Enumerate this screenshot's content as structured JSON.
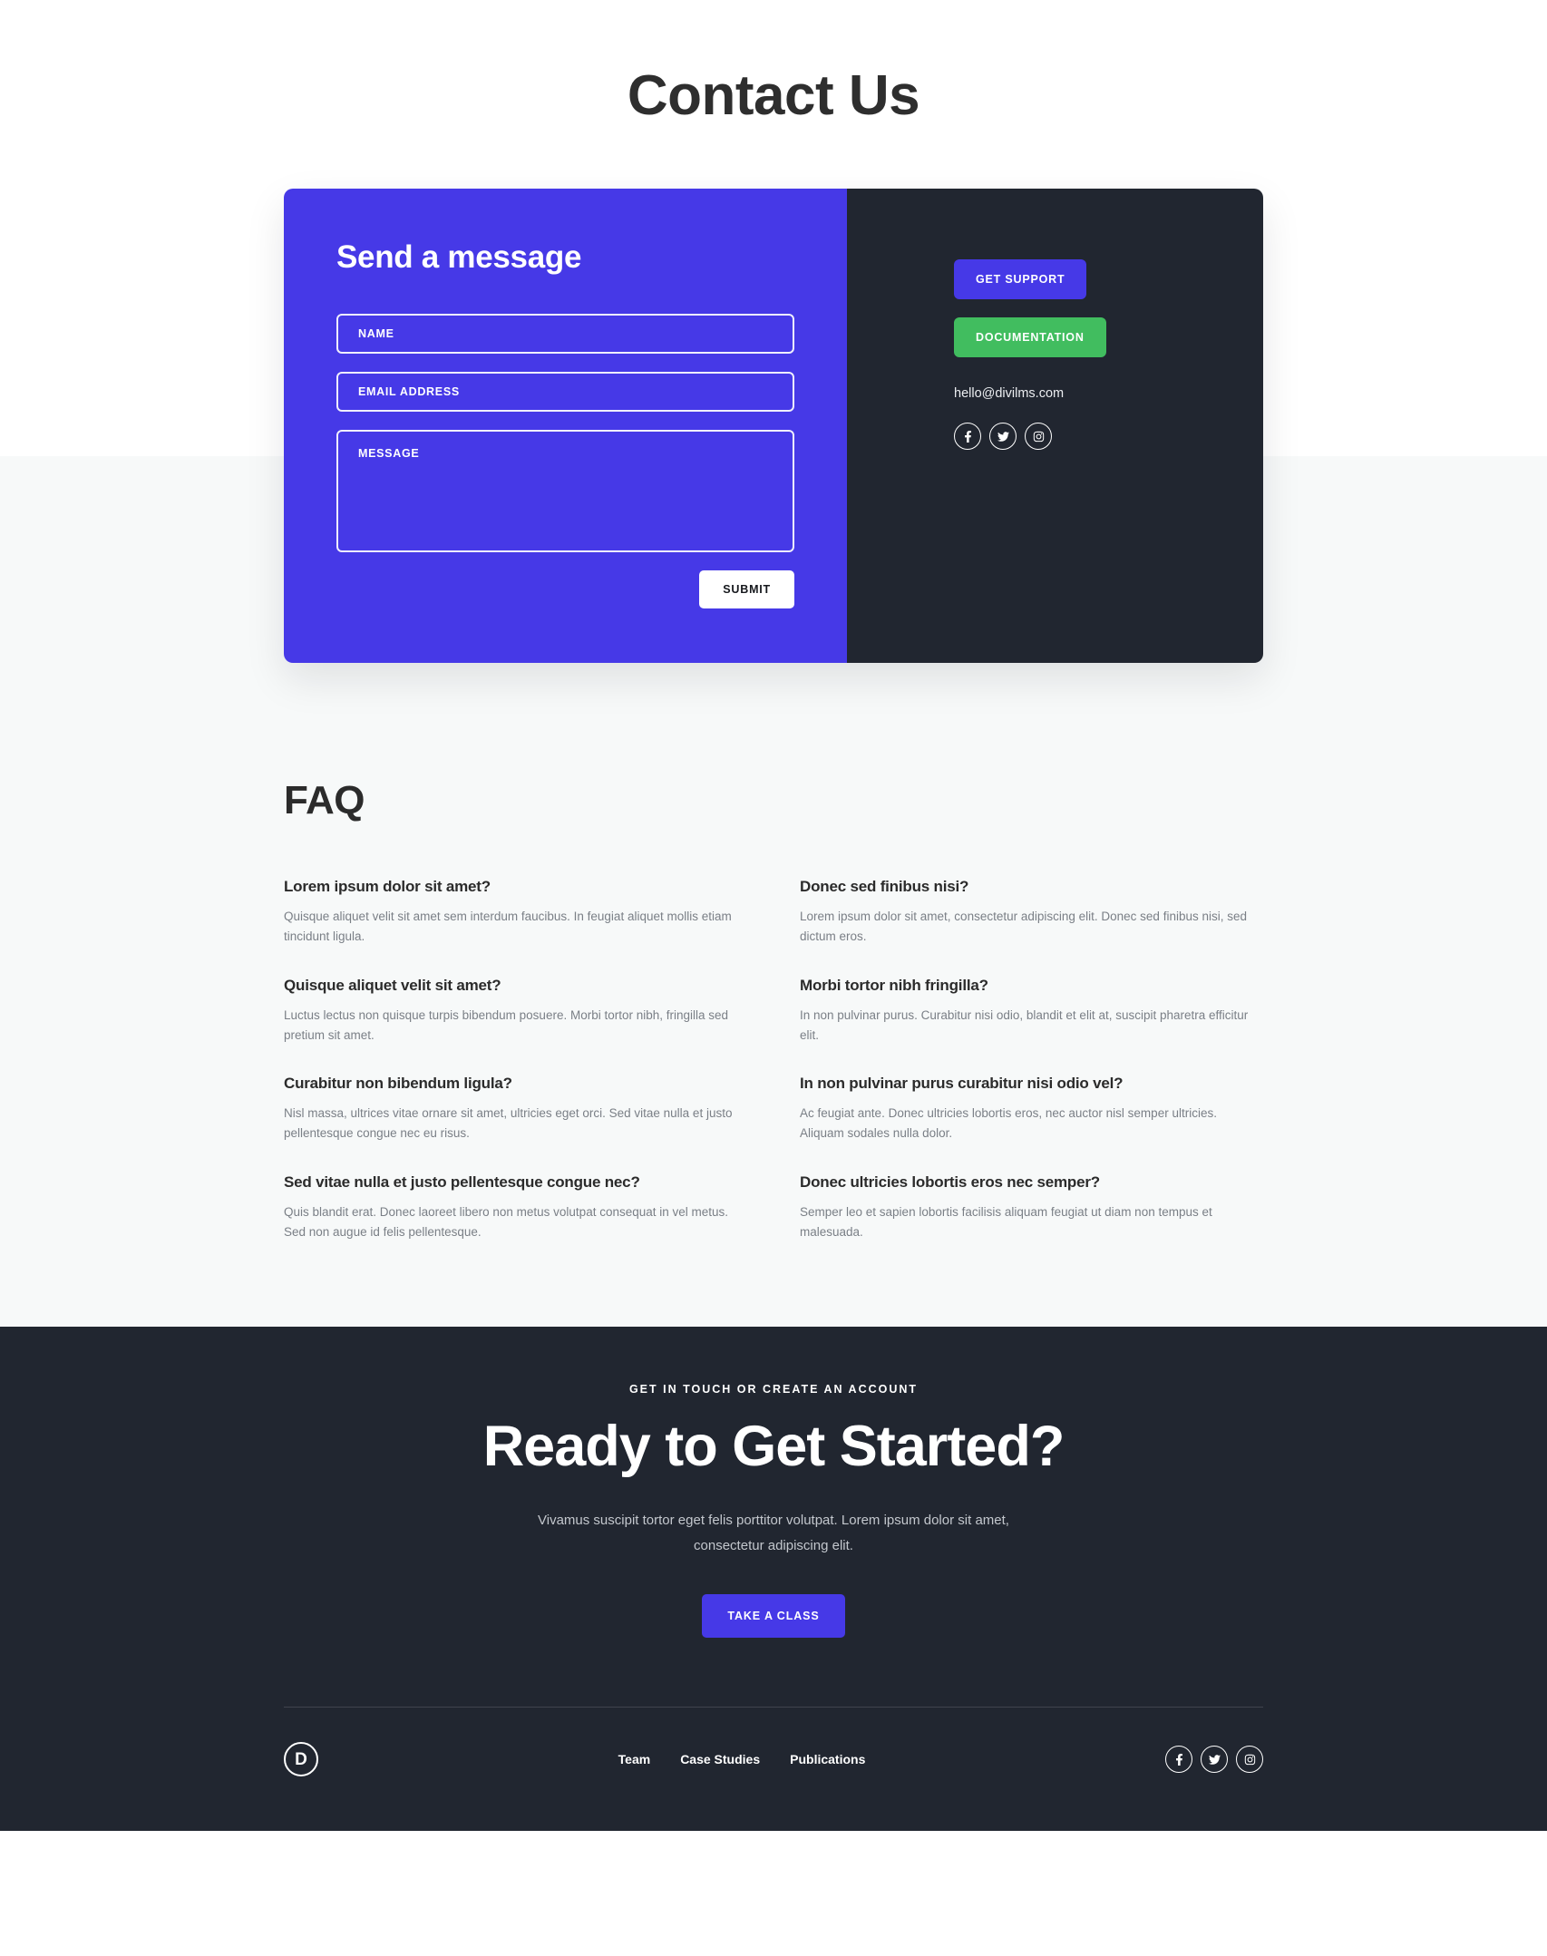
{
  "page": {
    "title": "Contact Us",
    "accent_blue": "#4639e7",
    "accent_green": "#41bd5f",
    "dark": "#212630",
    "light_bg": "#f7f9f9"
  },
  "contact_card": {
    "form": {
      "heading": "Send a message",
      "name_placeholder": "NAME",
      "name_value": "",
      "email_placeholder": "EMAIL ADDRESS",
      "email_value": "",
      "message_placeholder": "MESSAGE",
      "message_value": "",
      "submit_label": "SUBMIT"
    },
    "side": {
      "support_label": "GET SUPPORT",
      "docs_label": "DOCUMENTATION",
      "email": "hello@divilms.com",
      "social": [
        {
          "name": "facebook",
          "icon": "facebook-icon"
        },
        {
          "name": "twitter",
          "icon": "twitter-icon"
        },
        {
          "name": "instagram",
          "icon": "instagram-icon"
        }
      ]
    }
  },
  "faq": {
    "heading": "FAQ",
    "items_left": [
      {
        "question": "Lorem ipsum dolor sit amet?",
        "answer": "Quisque aliquet velit sit amet sem interdum faucibus. In feugiat aliquet mollis etiam tincidunt ligula."
      },
      {
        "question": "Quisque aliquet velit sit amet?",
        "answer": "Luctus lectus non quisque turpis bibendum posuere. Morbi tortor nibh, fringilla sed pretium sit amet."
      },
      {
        "question": "Curabitur non bibendum ligula?",
        "answer": "Nisl massa, ultrices vitae ornare sit amet, ultricies eget orci. Sed vitae nulla et justo pellentesque congue nec eu risus."
      },
      {
        "question": "Sed vitae nulla et justo pellentesque congue nec?",
        "answer": "Quis blandit erat. Donec laoreet libero non metus volutpat consequat in vel metus. Sed non augue id felis pellentesque."
      }
    ],
    "items_right": [
      {
        "question": "Donec sed finibus nisi?",
        "answer": "Lorem ipsum dolor sit amet, consectetur adipiscing elit. Donec sed finibus nisi, sed dictum eros."
      },
      {
        "question": "Morbi tortor nibh fringilla?",
        "answer": "In non pulvinar purus. Curabitur nisi odio, blandit et elit at, suscipit pharetra efficitur elit."
      },
      {
        "question": "In non pulvinar purus curabitur nisi odio vel?",
        "answer": "Ac feugiat ante. Donec ultricies lobortis eros, nec auctor nisl semper ultricies. Aliquam sodales nulla dolor."
      },
      {
        "question": "Donec ultricies lobortis eros nec semper?",
        "answer": "Semper leo et sapien lobortis facilisis aliquam feugiat ut diam non tempus et malesuada."
      }
    ]
  },
  "cta": {
    "eyebrow": "GET IN TOUCH OR CREATE AN ACCOUNT",
    "title": "Ready to Get Started?",
    "subtitle": "Vivamus suscipit tortor eget felis porttitor volutpat. Lorem ipsum dolor sit amet, consectetur adipiscing elit.",
    "button_label": "TAKE A CLASS"
  },
  "footer": {
    "logo_letter": "D",
    "links": [
      {
        "label": "Team"
      },
      {
        "label": "Case Studies"
      },
      {
        "label": "Publications"
      }
    ],
    "social": [
      {
        "name": "facebook",
        "icon": "facebook-icon"
      },
      {
        "name": "twitter",
        "icon": "twitter-icon"
      },
      {
        "name": "instagram",
        "icon": "instagram-icon"
      }
    ]
  }
}
